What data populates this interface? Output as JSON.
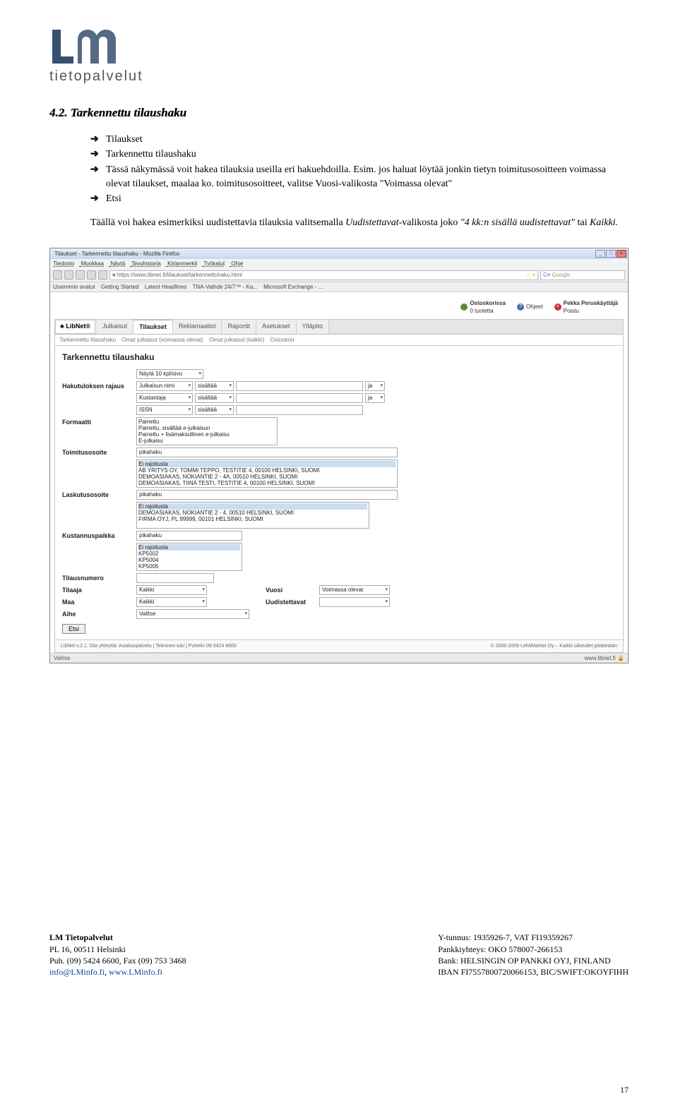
{
  "logo": {
    "subtitle": "tietopalvelut"
  },
  "section": {
    "heading": "4.2. Tarkennettu tilaushaku",
    "bullets": [
      "Tilaukset",
      "Tarkennettu tilaushaku",
      "Tässä näkymässä voit hakea tilauksia useilla eri hakuehdoilla. Esim. jos haluat löytää jonkin tietyn toimitusosoitteen voimassa olevat tilaukset, maalaa ko. toimitusosoitteet, valitse Vuosi-valikosta \"Voimassa olevat\"",
      "Etsi"
    ],
    "paragraph_parts": {
      "p1": "Täällä voi hakea esimerkiksi uudistettavia tilauksia valitsemalla ",
      "p2": "Uudistettavat",
      "p3": "-valikosta joko ",
      "p4": "\"4 kk:n sisällä uudistettavat\"",
      "p5": " tai ",
      "p6": "Kaikki."
    }
  },
  "browser": {
    "title": "Tilaukset - Tarkennettu tilaushaku - Mozilla Firefox",
    "menu": [
      "Tiedosto",
      "Muokkaa",
      "Näytä",
      "Sivuhistoria",
      "Kirjanmerkit",
      "Työkalut",
      "Ohje"
    ],
    "url": "https://www.libnet.fi/tilaukset/tarkennettuhaku.html",
    "search_placeholder": "Google",
    "bookmarks": [
      "Useimmin avatut",
      "Getting Started",
      "Latest Headlines",
      "TNA-Vaihde 24/7™ - Ka...",
      "Microsoft Exchange - ..."
    ],
    "status_left": "Valmis",
    "status_right": "www.libnet.fi"
  },
  "app": {
    "status": {
      "cart_label": "Ostoskorissa",
      "cart_count": "0 tuotetta",
      "help": "Ohjeet",
      "user": "Pekka Peruskäyttäjä",
      "logout": "Poistu"
    },
    "brand": "LibNet®",
    "tabs": [
      "Julkaisut",
      "Tilaukset",
      "Reklamaatiot",
      "Raportit",
      "Asetukset",
      "Ylläpito"
    ],
    "active_tab": 1,
    "subtabs": [
      "Tarkennettu tilaushaku",
      "Omat julkaisut (voimassa olevat)",
      "Omat julkaisut (kaikki)",
      "Ostoskori"
    ],
    "form": {
      "title": "Tarkennettu tilaushaku",
      "per_page": "Näytä 10 kpl/sivu",
      "hakutulos_label": "Hakutuloksen rajaus",
      "hakutulos_rows": [
        {
          "field": "Julkaisun nimi",
          "op": "sisältää",
          "bool": "ja"
        },
        {
          "field": "Kustantaja",
          "op": "sisältää",
          "bool": "ja"
        },
        {
          "field": "ISSN",
          "op": "sisältää",
          "bool": ""
        }
      ],
      "formaatti_label": "Formaatti",
      "formaatti_opts": [
        "Painettu",
        "Painettu, sisältää e-julkaisun",
        "Painettu + lisämaksullinen e-julkaisu",
        "E-julkaisu"
      ],
      "toimitus_label": "Toimitusosoite",
      "toimitus_ph": "pikahaku",
      "toimitus_opts": [
        "Ei rajoitusta",
        "AB YRITYS OY, TOMMI TEPPO, TESTITIE 4, 00100 HELSINKI, SUOMI",
        "DEMOASIAKAS, NOKIANTIE 2 - 4A, 00510 HELSINKI, SUOMI",
        "DEMOASIAKAS, TIINA TESTI, TESTITIE 4, 00100 HELSINKI, SUOMI"
      ],
      "laskutus_label": "Laskutusosoite",
      "laskutus_ph": "pikahaku",
      "laskutus_opts": [
        "Ei rajoitusta",
        "DEMOASIAKAS, NOKIANTIE 2 - 4, 00510 HELSINKI, SUOMI",
        "FIRMA OYJ, PL 99999, 00101 HELSINKI, SUOMI"
      ],
      "kustannus_label": "Kustannuspaikka",
      "kustannus_ph": "pikahaku",
      "kustannus_opts": [
        "Ei rajoitusta",
        "KP5002",
        "KP5004",
        "KP5005"
      ],
      "tilausnumero_label": "Tilausnumero",
      "tilaaja_label": "Tilaaja",
      "tilaaja_val": "Kaikki",
      "maa_label": "Maa",
      "maa_val": "Kaikki",
      "aihe_label": "Aihe",
      "aihe_val": "Valitse",
      "vuosi_label": "Vuosi",
      "vuosi_val": "Voimassa olevat",
      "uudist_label": "Uudistettavat",
      "uudist_val": "",
      "etsi_btn": "Etsi"
    },
    "footer_left": "LibNet v.2.1. Ota yhteyttä: Asiakaspalvelu | Tekninen tuki | Puhelin 09 5424 6600",
    "footer_right": "© 2006-2009 LehtiMarket Oy – Kaikki oikeudet pidätetään"
  },
  "footer": {
    "left": [
      "LM Tietopalvelut",
      "PL 16, 00511 Helsinki",
      "Puh. (09) 5424 6600, Fax (09) 753 3468",
      "info@LMinfo.fi, www.LMinfo.fi"
    ],
    "right": [
      "Y-tunnus: 1935926-7, VAT FI19359267",
      "Pankkiyhteys: OKO 578007-266153",
      "Bank: HELSINGIN OP PANKKI OYJ, FINLAND",
      "IBAN FI7557800720066153, BIC/SWIFT:OKOYFIHH"
    ],
    "page": "17"
  }
}
